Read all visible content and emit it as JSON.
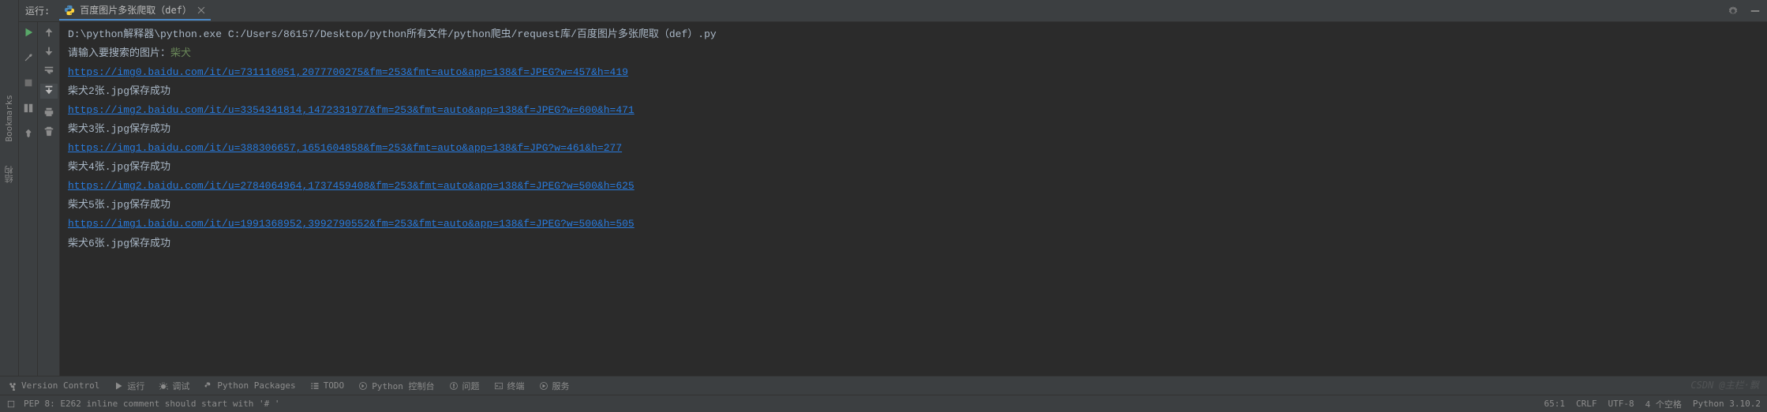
{
  "header": {
    "run_label": "运行:",
    "tab_title": "百度图片多张爬取（def）"
  },
  "sidebar": {
    "bookmarks": "Bookmarks",
    "structure": "结构"
  },
  "console": {
    "exec_line": "D:\\python解释器\\python.exe C:/Users/86157/Desktop/python所有文件/python爬虫/request库/百度图片多张爬取（def）.py",
    "prompt_prefix": "请输入要搜索的图片：",
    "prompt_input": "柴犬",
    "lines": [
      {
        "type": "link",
        "text": "https://img0.baidu.com/it/u=731116051,2077700275&fm=253&fmt=auto&app=138&f=JPEG?w=457&h=419"
      },
      {
        "type": "plain",
        "text": "柴犬2张.jpg保存成功"
      },
      {
        "type": "link",
        "text": "https://img2.baidu.com/it/u=3354341814,1472331977&fm=253&fmt=auto&app=138&f=JPEG?w=600&h=471"
      },
      {
        "type": "plain",
        "text": "柴犬3张.jpg保存成功"
      },
      {
        "type": "link",
        "text": "https://img1.baidu.com/it/u=388306657,1651604858&fm=253&fmt=auto&app=138&f=JPG?w=461&h=277"
      },
      {
        "type": "plain",
        "text": "柴犬4张.jpg保存成功"
      },
      {
        "type": "link",
        "text": "https://img2.baidu.com/it/u=2784064964,1737459408&fm=253&fmt=auto&app=138&f=JPEG?w=500&h=625"
      },
      {
        "type": "plain",
        "text": "柴犬5张.jpg保存成功"
      },
      {
        "type": "link",
        "text": "https://img1.baidu.com/it/u=1991368952,3992790552&fm=253&fmt=auto&app=138&f=JPEG?w=500&h=505"
      },
      {
        "type": "plain",
        "text": "柴犬6张.jpg保存成功"
      }
    ]
  },
  "toolwindows": {
    "vcs": "Version Control",
    "run": "运行",
    "debug": "调试",
    "packages": "Python Packages",
    "todo": "TODO",
    "python_console": "Python 控制台",
    "problems": "问题",
    "terminal": "终端",
    "services": "服务"
  },
  "statusbar": {
    "message": "PEP 8: E262 inline comment should start with '# '",
    "position": "65:1",
    "line_ending": "CRLF",
    "encoding": "UTF-8",
    "indent": "4 个空格",
    "interpreter": "Python 3.10.2",
    "watermark": "CSDN @主栏·飘"
  }
}
